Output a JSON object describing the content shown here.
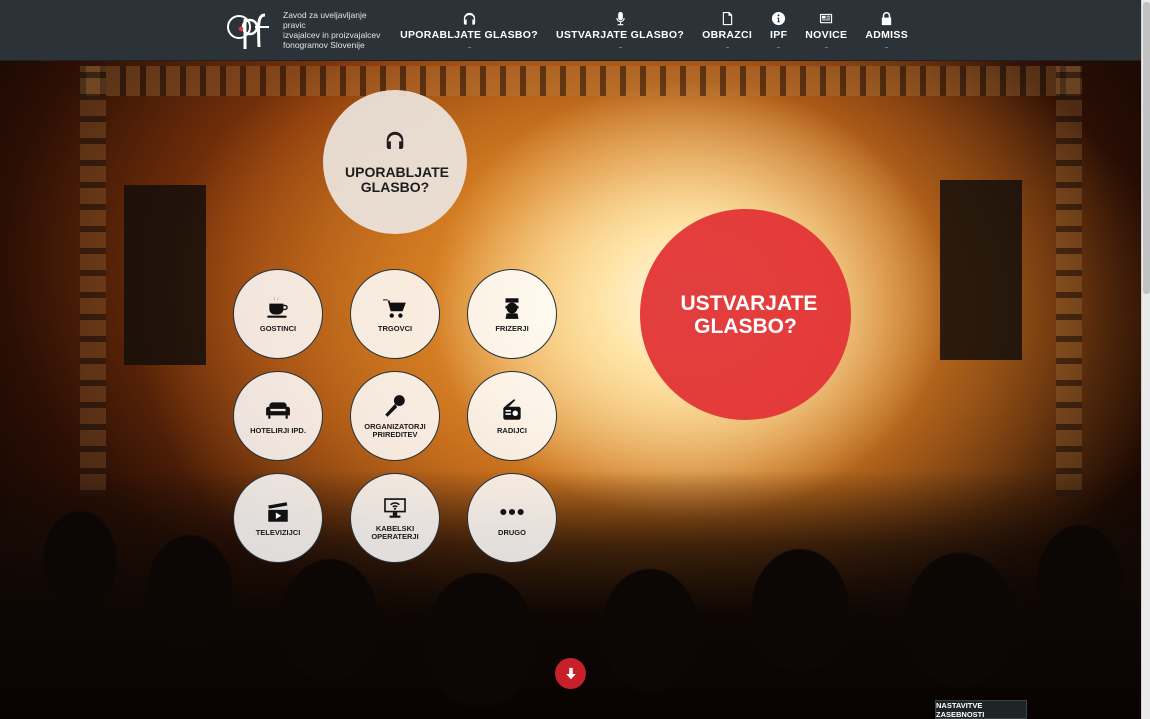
{
  "header": {
    "logo_lines": [
      "Zavod za uveljavljanje pravic",
      "izvajalcev in proizvajalcev",
      "fonogramov Slovenije"
    ],
    "nav": [
      {
        "label": "UPORABLJATE GLASBO?",
        "icon": "headphones-icon"
      },
      {
        "label": "USTVARJATE GLASBO?",
        "icon": "microphone-icon"
      },
      {
        "label": "OBRAZCI",
        "icon": "document-icon"
      },
      {
        "label": "IPF",
        "icon": "info-icon"
      },
      {
        "label": "NOVICE",
        "icon": "newspaper-icon"
      },
      {
        "label": "ADMISS",
        "icon": "lock-icon"
      }
    ]
  },
  "hero": {
    "use_music": "UPORABLJATE GLASBO?",
    "create_music": "USTVARJATE GLASBO?",
    "categories": [
      {
        "label": "GOSTINCI",
        "icon": "coffee-cup-icon"
      },
      {
        "label": "TRGOVCI",
        "icon": "shopping-cart-icon"
      },
      {
        "label": "FRIZERJI",
        "icon": "barber-icon"
      },
      {
        "label": "HOTELIRJI IPD.",
        "icon": "sofa-icon"
      },
      {
        "label": "ORGANIZATORJI PRIREDITEV",
        "icon": "microphone-icon"
      },
      {
        "label": "RADIJCI",
        "icon": "radio-icon"
      },
      {
        "label": "TELEVIZIJCI",
        "icon": "clapperboard-icon"
      },
      {
        "label": "KABELSKI OPERATERJI",
        "icon": "monitor-wifi-icon"
      },
      {
        "label": "DRUGO",
        "icon": "ellipsis-icon"
      }
    ]
  },
  "footer": {
    "privacy_label": "NASTAVITVE ZASEBNOSTI"
  },
  "colors": {
    "header_bg": "#2b3338",
    "accent_red": "#e23436",
    "scroll_button": "#c8202b"
  }
}
